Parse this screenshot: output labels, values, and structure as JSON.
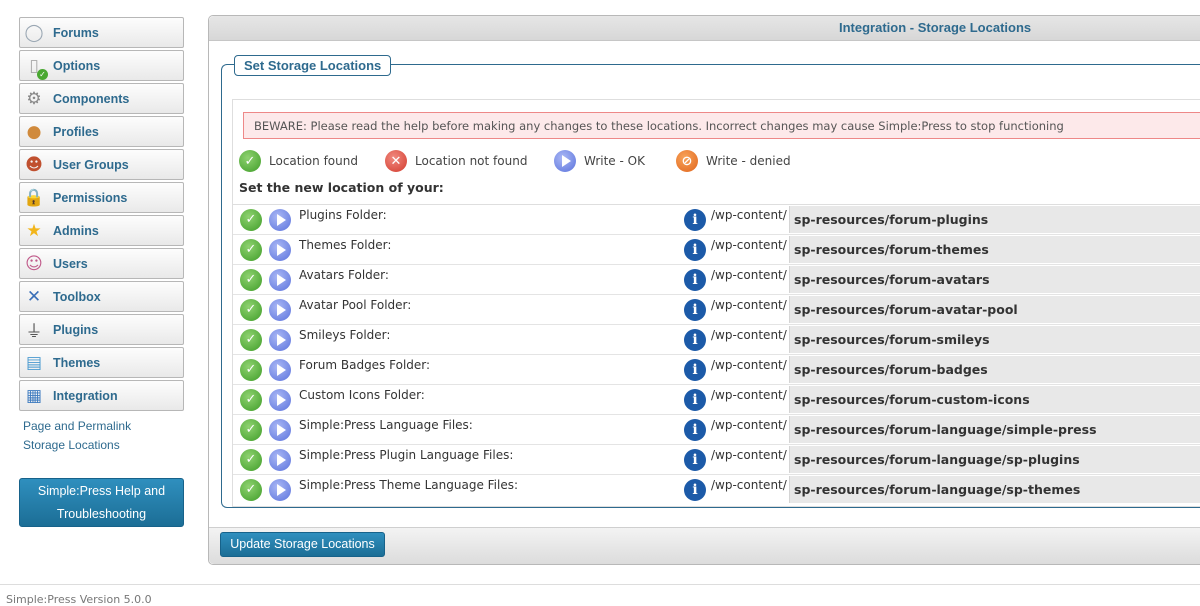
{
  "sidebar": {
    "items": [
      {
        "label": "Forums",
        "icon": "forums-icon",
        "glyph": "◯",
        "color": "#9aa7b3"
      },
      {
        "label": "Options",
        "icon": "options-icon",
        "glyph": "▯",
        "color": "#a8a8a8"
      },
      {
        "label": "Components",
        "icon": "components-icon",
        "glyph": "⚙",
        "color": "#888888"
      },
      {
        "label": "Profiles",
        "icon": "profiles-icon",
        "glyph": "●",
        "color": "#d08a3c"
      },
      {
        "label": "User Groups",
        "icon": "user-groups-icon",
        "glyph": "☻",
        "color": "#c0502f"
      },
      {
        "label": "Permissions",
        "icon": "permissions-icon",
        "glyph": "🔒",
        "color": "#d4a21c"
      },
      {
        "label": "Admins",
        "icon": "admins-icon",
        "glyph": "★",
        "color": "#f2b51a"
      },
      {
        "label": "Users",
        "icon": "users-icon",
        "glyph": "☺",
        "color": "#c05a8a"
      },
      {
        "label": "Toolbox",
        "icon": "toolbox-icon",
        "glyph": "✕",
        "color": "#3a6fb8"
      },
      {
        "label": "Plugins",
        "icon": "plugins-icon",
        "glyph": "⏚",
        "color": "#555555"
      },
      {
        "label": "Themes",
        "icon": "themes-icon",
        "glyph": "▤",
        "color": "#4a9ad0"
      },
      {
        "label": "Integration",
        "icon": "integration-icon",
        "glyph": "▦",
        "color": "#3f7cc0"
      }
    ],
    "sub_links": [
      "Page and Permalink",
      "Storage Locations"
    ],
    "help_line1": "Simple:Press Help and",
    "help_line2": "Troubleshooting"
  },
  "panel": {
    "title": "Integration - Storage Locations",
    "legend": "Set Storage Locations",
    "warning": "BEWARE: Please read the help before making any changes to these locations. Incorrect changes may cause Simple:Press to stop functioning",
    "status_legend": {
      "found": "Location found",
      "not_found": "Location not found",
      "write_ok": "Write - OK",
      "write_denied": "Write - denied"
    },
    "set_label": "Set the new location of your:",
    "prefix": "/wp-content/",
    "rows": [
      {
        "label": "Plugins Folder:",
        "path": "sp-resources/forum-plugins"
      },
      {
        "label": "Themes Folder:",
        "path": "sp-resources/forum-themes"
      },
      {
        "label": "Avatars Folder:",
        "path": "sp-resources/forum-avatars"
      },
      {
        "label": "Avatar Pool Folder:",
        "path": "sp-resources/forum-avatar-pool"
      },
      {
        "label": "Smileys Folder:",
        "path": "sp-resources/forum-smileys"
      },
      {
        "label": "Forum Badges Folder:",
        "path": "sp-resources/forum-badges"
      },
      {
        "label": "Custom Icons Folder:",
        "path": "sp-resources/forum-custom-icons"
      },
      {
        "label": "Simple:Press Language Files:",
        "path": "sp-resources/forum-language/simple-press"
      },
      {
        "label": "Simple:Press Plugin Language Files:",
        "path": "sp-resources/forum-language/sp-plugins"
      },
      {
        "label": "Simple:Press Theme Language Files:",
        "path": "sp-resources/forum-language/sp-themes"
      }
    ],
    "update_button": "Update Storage Locations"
  },
  "footer": {
    "text": "Simple:Press Version 5.0.0"
  }
}
